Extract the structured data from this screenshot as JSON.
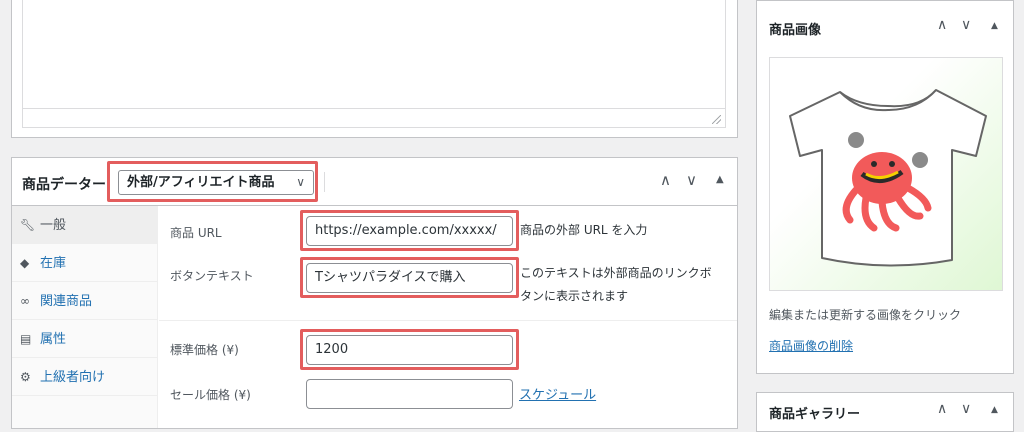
{
  "product_data": {
    "title": "商品データー",
    "type_select": "外部/アフィリエイト商品",
    "tabs": [
      {
        "label": "一般",
        "icon": "wrench-icon"
      },
      {
        "label": "在庫",
        "icon": "tag-icon"
      },
      {
        "label": "関連商品",
        "icon": "link-icon"
      },
      {
        "label": "属性",
        "icon": "table-icon"
      },
      {
        "label": "上級者向け",
        "icon": "gear-icon"
      }
    ],
    "fields": {
      "product_url_label": "商品 URL",
      "product_url_value": "https://example.com/xxxxx/",
      "product_url_desc": "商品の外部 URL を入力",
      "button_text_label": "ボタンテキスト",
      "button_text_value": "Tシャツパラダイスで購入",
      "button_text_desc_1": "このテキストは外部商品のリンクボ",
      "button_text_desc_2": "タンに表示されます",
      "regular_price_label": "標準価格 (¥)",
      "regular_price_value": "1200",
      "sale_price_label": "セール価格 (¥)",
      "sale_price_value": "",
      "schedule_link": "スケジュール"
    }
  },
  "product_image": {
    "title": "商品画像",
    "hint": "編集または更新する画像をクリック",
    "remove_link": "商品画像の削除"
  },
  "product_gallery": {
    "title": "商品ギャラリー"
  },
  "colors": {
    "highlight": "#e35d5d",
    "link": "#2271b1",
    "octopus": "#f25a5a"
  }
}
